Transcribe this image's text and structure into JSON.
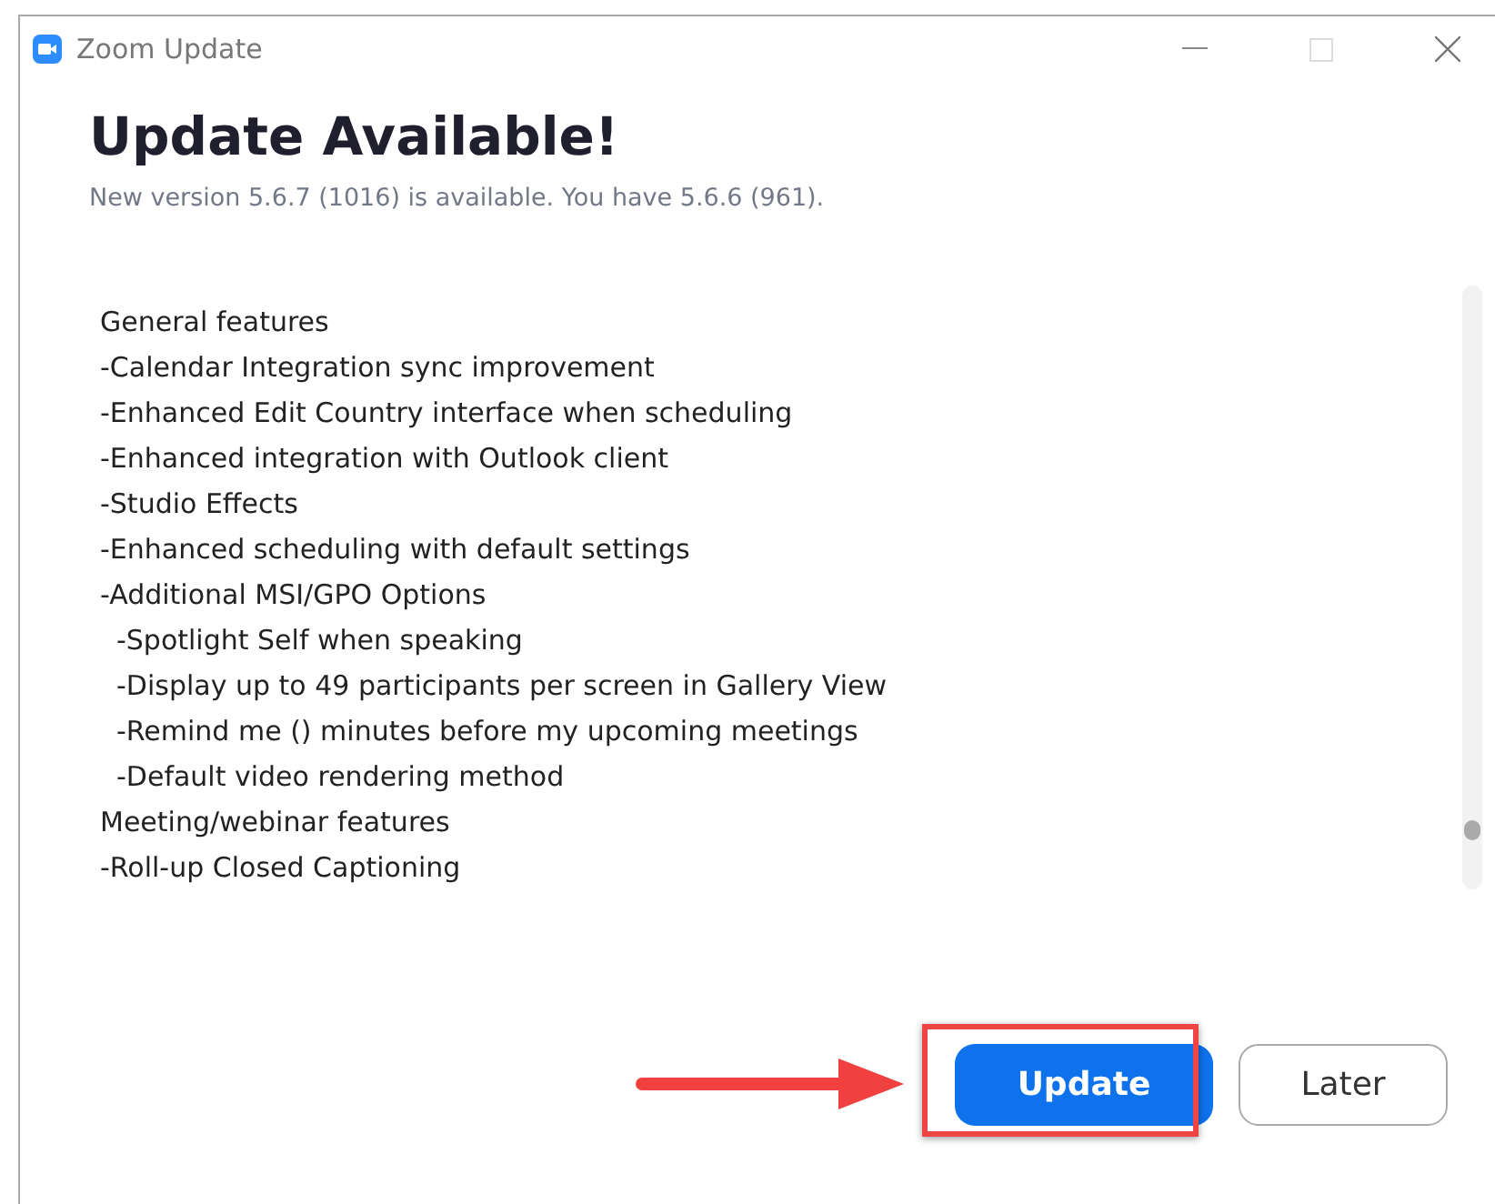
{
  "window": {
    "title": "Zoom Update"
  },
  "heading": "Update Available!",
  "subtitle": "New version 5.6.7 (1016) is available. You have 5.6.6 (961).",
  "notes": [
    {
      "text": "General features"
    },
    {
      "text": "-Calendar Integration sync improvement"
    },
    {
      "text": "-Enhanced Edit Country interface when scheduling"
    },
    {
      "text": "-Enhanced integration with Outlook client"
    },
    {
      "text": "-Studio Effects"
    },
    {
      "text": "-Enhanced scheduling with default settings"
    },
    {
      "text": "-Additional MSI/GPO Options",
      "children": [
        {
          "text": "-Spotlight Self when speaking"
        },
        {
          "text": "-Display up to 49 participants per screen in Gallery View"
        },
        {
          "text": "-Remind me () minutes before my upcoming meetings"
        },
        {
          "text": "-Default video rendering method"
        }
      ]
    },
    {
      "text": "Meeting/webinar features"
    },
    {
      "text": "-Roll-up Closed Captioning"
    }
  ],
  "buttons": [
    {
      "label": "Update",
      "kind": "primary"
    },
    {
      "label": "Later",
      "kind": "secondary"
    }
  ]
}
